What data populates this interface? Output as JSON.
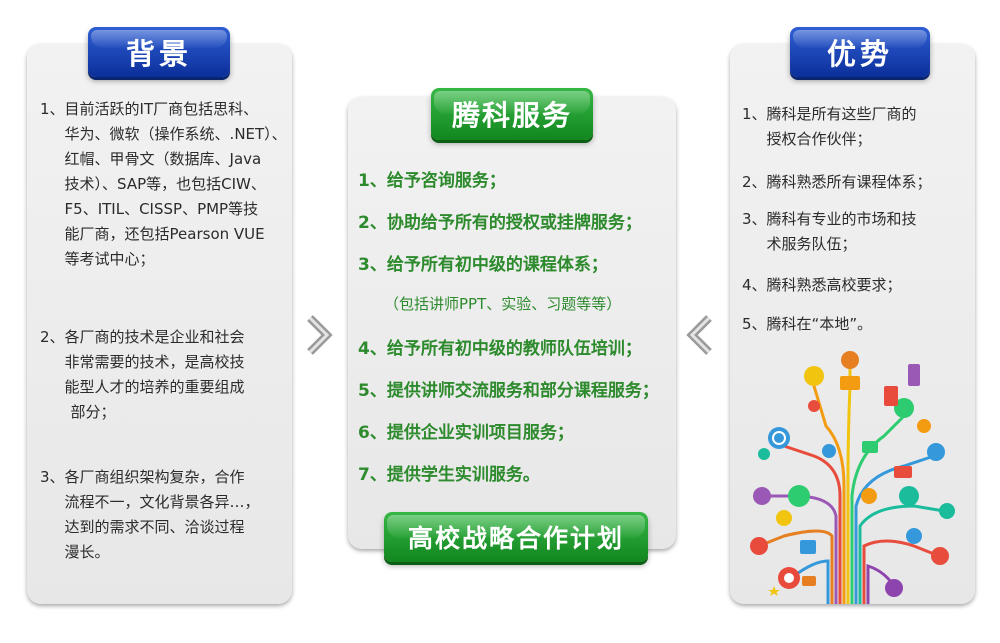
{
  "left": {
    "title": "背景",
    "items": [
      {
        "num": "1、",
        "lines": [
          "目前活跃的IT厂商包括思科、",
          "华为、微软（操作系统、.NET）、",
          "红帽、甲骨文（数据库、Java",
          "技术）、SAP等，也包括CIW、",
          "F5、ITIL、CISSP、PMP等技",
          "能厂商，还包括Pearson VUE",
          "等考试中心；"
        ]
      },
      {
        "num": "2、",
        "lines": [
          "各厂商的技术是企业和社会",
          "非常需要的技术，是高校技",
          "能型人才的培养的重要组成",
          "部分；"
        ]
      },
      {
        "num": "3、",
        "lines": [
          "各厂商组织架构复杂，合作",
          "流程不一，文化背景各异…，",
          "达到的需求不同、洽谈过程",
          "漫长。"
        ]
      }
    ]
  },
  "middle": {
    "title": "腾科服务",
    "items": [
      "1、给予咨询服务；",
      "2、协助给予所有的授权或挂牌服务；",
      "3、给予所有初中级的课程体系；",
      "4、给予所有初中级的教师队伍培训；",
      "5、提供讲师交流服务和部分课程服务；",
      "6、提供企业实训项目服务；",
      "7、提供学生实训服务。"
    ],
    "sub_note": "（包括讲师PPT、实验、习题等等）",
    "footer": "高校战略合作计划"
  },
  "right": {
    "title": "优势",
    "items": [
      {
        "num": "1、",
        "lines": [
          "腾科是所有这些厂商的",
          "授权合作伙伴；"
        ]
      },
      {
        "num": "2、",
        "lines": [
          "腾科熟悉所有课程体系；"
        ]
      },
      {
        "num": "3、",
        "lines": [
          "腾科有专业的市场和技",
          "术服务队伍；"
        ]
      },
      {
        "num": "4、",
        "lines": [
          "腾科熟悉高校要求；"
        ]
      },
      {
        "num": "5、",
        "lines": [
          "腾科在“本地”。"
        ]
      }
    ]
  },
  "colors": {
    "blue_tab": "#1a45b8",
    "green_tab": "#22a032",
    "green_text": "#2d8a2d",
    "panel_bg": "#ececec"
  },
  "icons": [
    "chevron-right-icon",
    "chevron-left-icon",
    "tech-tree-illustration"
  ]
}
